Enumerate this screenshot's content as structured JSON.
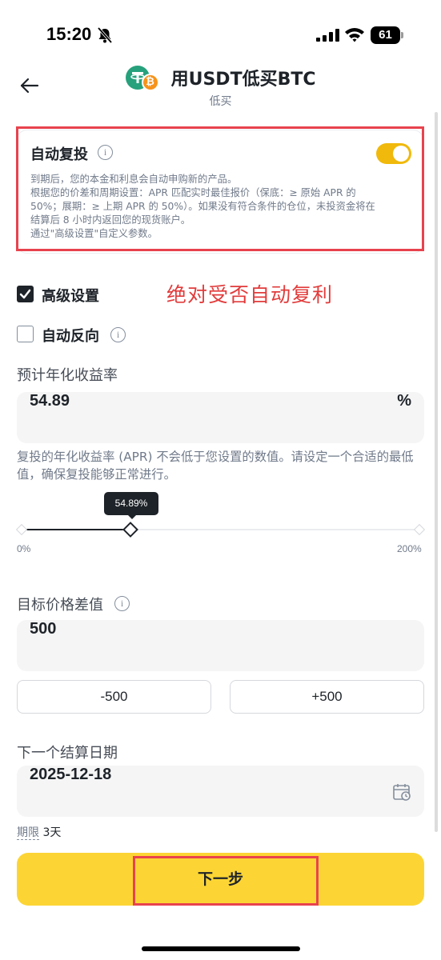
{
  "status_bar": {
    "time": "15:20",
    "battery": "61"
  },
  "header": {
    "title": "用USDT低买BTC",
    "subtitle": "低买",
    "coin_badge": "₿"
  },
  "auto_reinvest": {
    "title": "自动复投",
    "info_glyph": "i",
    "enabled": true,
    "desc_lines": [
      "到期后，您的本金和利息会自动申购新的产品。",
      "根据您的价差和周期设置：APR 匹配实时最佳报价（保底：≥ 原始 APR 的",
      "50%；展期：≥ 上期 APR 的 50%）。如果没有符合条件的仓位，未投资金将在",
      "结算后 8 小时内返回您的现货账户。",
      "通过\"高级设置\"自定义参数。"
    ]
  },
  "annotation": "绝对受否自动复利",
  "advanced_settings": {
    "label": "高级设置",
    "checked": true
  },
  "auto_reverse": {
    "label": "自动反向",
    "checked": false,
    "info_glyph": "i"
  },
  "apr": {
    "label": "预计年化收益率",
    "value": "54.89",
    "unit": "%",
    "hint": "复投的年化收益率 (APR) 不会低于您设置的数值。请设定一个合适的最低值，确保复投能够正常进行。",
    "slider": {
      "tooltip": "54.89%",
      "min_label": "0%",
      "max_label": "200%",
      "fraction": 0.27
    }
  },
  "price_diff": {
    "label": "目标价格差值",
    "info_glyph": "i",
    "value": "500",
    "minus_label": "-500",
    "plus_label": "+500"
  },
  "settlement": {
    "label": "下一个结算日期",
    "value": "2025-12-18",
    "icon": "calendar-icon",
    "term_label": "期限",
    "term_value": "3天"
  },
  "next_button": {
    "label": "下一步"
  },
  "colors": {
    "accent": "#fcd535",
    "toggle": "#f0b90b",
    "highlight": "#e8434e",
    "usdt": "#26a17b",
    "btc": "#f7931a"
  }
}
